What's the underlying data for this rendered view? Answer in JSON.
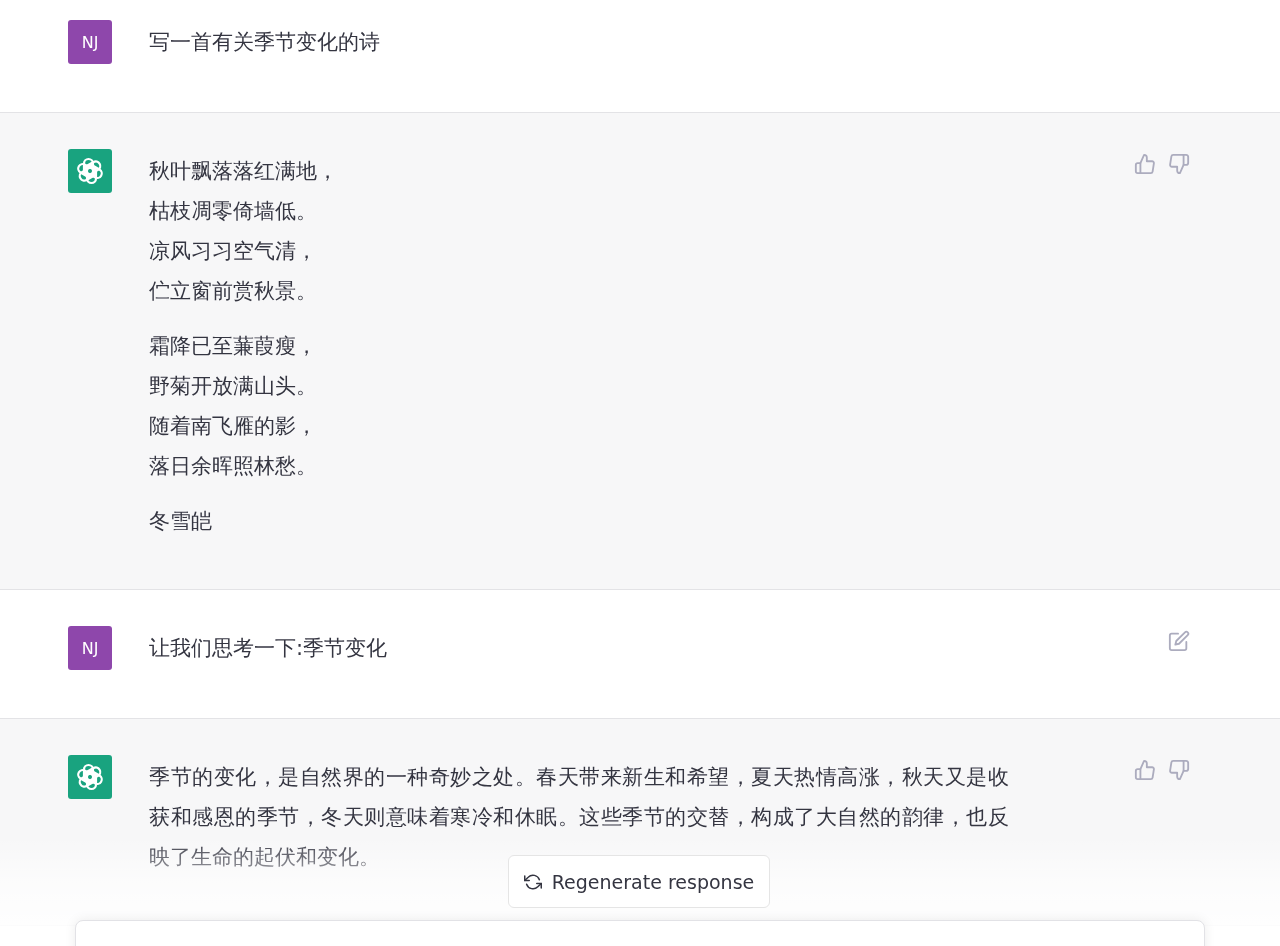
{
  "messages": [
    {
      "kind": "user",
      "avatar": "NJ",
      "paragraphs": [
        [
          "写一首有关季节变化的诗"
        ]
      ]
    },
    {
      "kind": "assistant",
      "paragraphs": [
        [
          "秋叶飘落落红满地，",
          "枯枝凋零倚墙低。",
          "凉风习习空气清，",
          "伫立窗前赏秋景。"
        ],
        [
          "霜降已至蒹葭瘦，",
          "野菊开放满山头。",
          "随着南飞雁的影，",
          "落日余晖照林愁。"
        ],
        [
          "冬雪皑"
        ]
      ],
      "actions": [
        {
          "kind": "thumbs_up"
        },
        {
          "kind": "thumbs_down"
        }
      ]
    },
    {
      "kind": "user",
      "avatar": "NJ",
      "paragraphs": [
        [
          "让我们思考一下:季节变化"
        ]
      ],
      "actions": [
        {
          "kind": "edit"
        }
      ]
    },
    {
      "kind": "assistant",
      "paragraphs": [
        [
          "季节的变化，是自然界的一种奇妙之处。春天带来新生和希望，夏天热情高涨，秋天又是收获和感恩的季节，冬天则意味着寒冷和休眠。这些季节的交替，构成了大自然的韵律，也反映了生命的起伏和变化。"
        ]
      ],
      "actions": [
        {
          "kind": "thumbs_up"
        },
        {
          "kind": "thumbs_down"
        }
      ]
    }
  ],
  "regenerate_button": {
    "label": "Regenerate response"
  }
}
